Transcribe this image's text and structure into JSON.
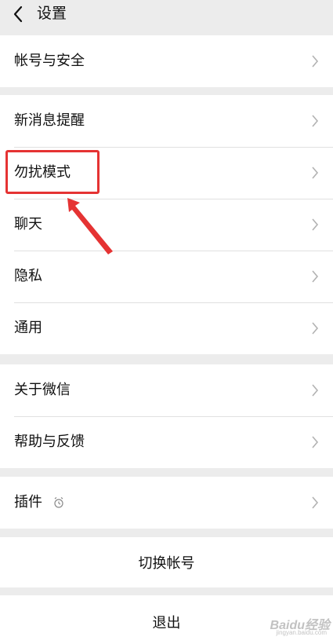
{
  "header": {
    "title": "设置",
    "back_icon": "chevron-left-icon"
  },
  "groups": [
    {
      "items": [
        {
          "label": "帐号与安全"
        }
      ]
    },
    {
      "items": [
        {
          "label": "新消息提醒"
        },
        {
          "label": "勿扰模式"
        },
        {
          "label": "聊天"
        },
        {
          "label": "隐私"
        },
        {
          "label": "通用"
        }
      ]
    },
    {
      "items": [
        {
          "label": "关于微信"
        },
        {
          "label": "帮助与反馈"
        }
      ]
    },
    {
      "items": [
        {
          "label": "插件",
          "icon": "plugin-icon"
        }
      ]
    }
  ],
  "buttons": {
    "switch_account": "切换帐号",
    "logout": "退出"
  },
  "annotation": {
    "color": "#e53333",
    "highlighted_item": "勿扰模式"
  },
  "watermark": {
    "text": "Baidu经验",
    "url": "jingyan.baidu.com"
  },
  "colors": {
    "background": "#ececec",
    "row_background": "#ffffff",
    "chevron": "#b2b2b2"
  }
}
